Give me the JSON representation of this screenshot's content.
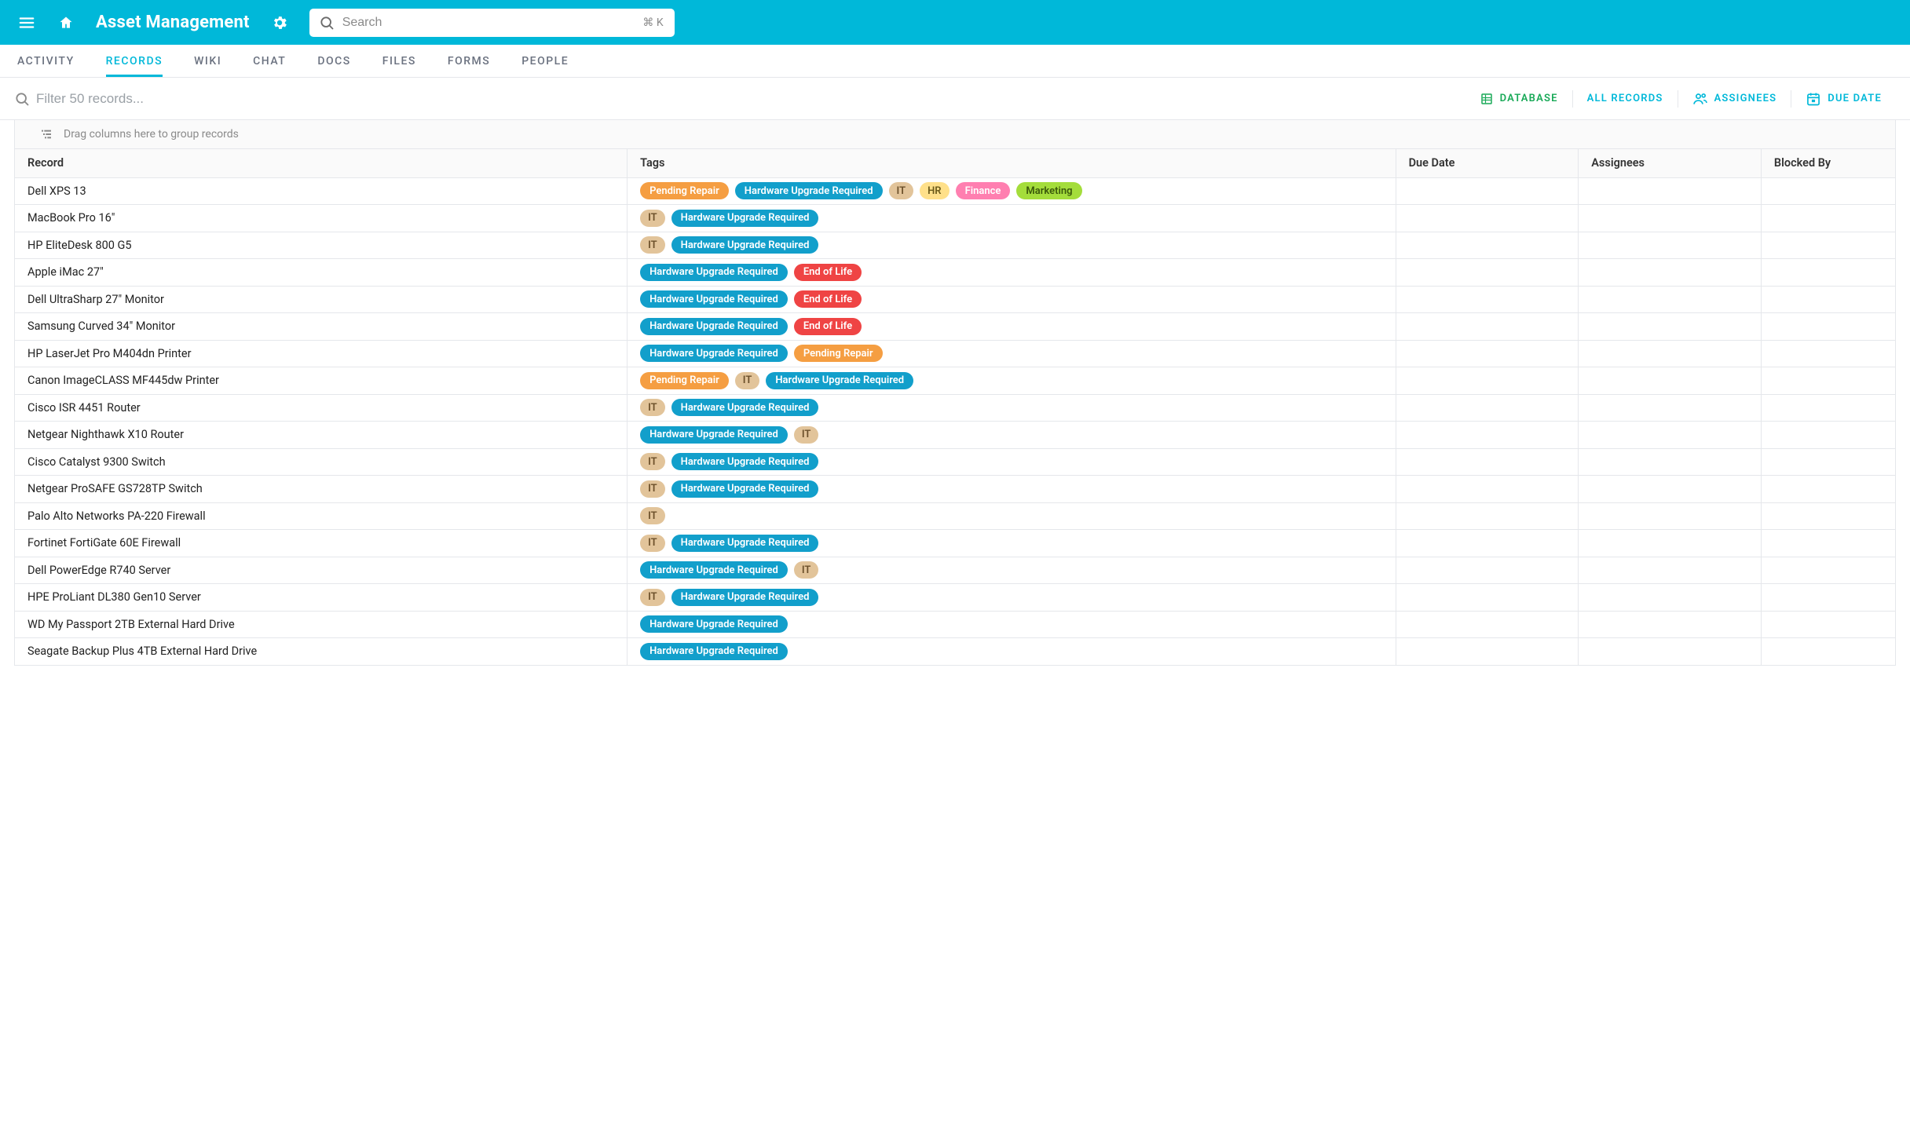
{
  "header": {
    "title": "Asset Management",
    "search_placeholder": "Search",
    "search_shortcut": "⌘ K"
  },
  "nav_tabs": [
    {
      "id": "activity",
      "label": "ACTIVITY",
      "active": false
    },
    {
      "id": "records",
      "label": "RECORDS",
      "active": true
    },
    {
      "id": "wiki",
      "label": "WIKI",
      "active": false
    },
    {
      "id": "chat",
      "label": "CHAT",
      "active": false
    },
    {
      "id": "docs",
      "label": "DOCS",
      "active": false
    },
    {
      "id": "files",
      "label": "FILES",
      "active": false
    },
    {
      "id": "forms",
      "label": "FORMS",
      "active": false
    },
    {
      "id": "people",
      "label": "PEOPLE",
      "active": false
    }
  ],
  "toolbar": {
    "filter_placeholder": "Filter 50 records...",
    "actions": {
      "database": "DATABASE",
      "allrecords": "ALL RECORDS",
      "assignees": "ASSIGNEES",
      "duedate": "DUE DATE"
    }
  },
  "groupbar": {
    "hint": "Drag columns here to group records"
  },
  "columns": [
    {
      "id": "record",
      "label": "Record"
    },
    {
      "id": "tags",
      "label": "Tags"
    },
    {
      "id": "due",
      "label": "Due Date"
    },
    {
      "id": "assign",
      "label": "Assignees"
    },
    {
      "id": "blocked",
      "label": "Blocked By"
    }
  ],
  "tag_palette": {
    "Pending Repair": {
      "bg": "#f59e42",
      "fg": "#ffffff"
    },
    "Hardware Upgrade Required": {
      "bg": "#129fcb",
      "fg": "#ffffff"
    },
    "IT": {
      "bg": "#e2c49a",
      "fg": "#6b4f2a"
    },
    "HR": {
      "bg": "#ffe08a",
      "fg": "#6b5a1a"
    },
    "Finance": {
      "bg": "#ff7fb0",
      "fg": "#ffffff"
    },
    "Marketing": {
      "bg": "#a4dd3b",
      "fg": "#3b5a0b"
    },
    "End of Life": {
      "bg": "#ef4444",
      "fg": "#ffffff"
    }
  },
  "rows": [
    {
      "record": "Dell XPS 13",
      "tags": [
        "Pending Repair",
        "Hardware Upgrade Required",
        "IT",
        "HR",
        "Finance",
        "Marketing"
      ],
      "due": "",
      "assignees": "",
      "blocked": ""
    },
    {
      "record": "MacBook Pro 16\"",
      "tags": [
        "IT",
        "Hardware Upgrade Required"
      ],
      "due": "",
      "assignees": "",
      "blocked": ""
    },
    {
      "record": "HP EliteDesk 800 G5",
      "tags": [
        "IT",
        "Hardware Upgrade Required"
      ],
      "due": "",
      "assignees": "",
      "blocked": ""
    },
    {
      "record": "Apple iMac 27\"",
      "tags": [
        "Hardware Upgrade Required",
        "End of Life"
      ],
      "due": "",
      "assignees": "",
      "blocked": ""
    },
    {
      "record": "Dell UltraSharp 27\" Monitor",
      "tags": [
        "Hardware Upgrade Required",
        "End of Life"
      ],
      "due": "",
      "assignees": "",
      "blocked": ""
    },
    {
      "record": "Samsung Curved 34\" Monitor",
      "tags": [
        "Hardware Upgrade Required",
        "End of Life"
      ],
      "due": "",
      "assignees": "",
      "blocked": ""
    },
    {
      "record": "HP LaserJet Pro M404dn Printer",
      "tags": [
        "Hardware Upgrade Required",
        "Pending Repair"
      ],
      "due": "",
      "assignees": "",
      "blocked": ""
    },
    {
      "record": "Canon ImageCLASS MF445dw Printer",
      "tags": [
        "Pending Repair",
        "IT",
        "Hardware Upgrade Required"
      ],
      "due": "",
      "assignees": "",
      "blocked": ""
    },
    {
      "record": "Cisco ISR 4451 Router",
      "tags": [
        "IT",
        "Hardware Upgrade Required"
      ],
      "due": "",
      "assignees": "",
      "blocked": ""
    },
    {
      "record": "Netgear Nighthawk X10 Router",
      "tags": [
        "Hardware Upgrade Required",
        "IT"
      ],
      "due": "",
      "assignees": "",
      "blocked": ""
    },
    {
      "record": "Cisco Catalyst 9300 Switch",
      "tags": [
        "IT",
        "Hardware Upgrade Required"
      ],
      "due": "",
      "assignees": "",
      "blocked": ""
    },
    {
      "record": "Netgear ProSAFE GS728TP Switch",
      "tags": [
        "IT",
        "Hardware Upgrade Required"
      ],
      "due": "",
      "assignees": "",
      "blocked": ""
    },
    {
      "record": "Palo Alto Networks PA-220 Firewall",
      "tags": [
        "IT"
      ],
      "due": "",
      "assignees": "",
      "blocked": ""
    },
    {
      "record": "Fortinet FortiGate 60E Firewall",
      "tags": [
        "IT",
        "Hardware Upgrade Required"
      ],
      "due": "",
      "assignees": "",
      "blocked": ""
    },
    {
      "record": "Dell PowerEdge R740 Server",
      "tags": [
        "Hardware Upgrade Required",
        "IT"
      ],
      "due": "",
      "assignees": "",
      "blocked": ""
    },
    {
      "record": "HPE ProLiant DL380 Gen10 Server",
      "tags": [
        "IT",
        "Hardware Upgrade Required"
      ],
      "due": "",
      "assignees": "",
      "blocked": ""
    },
    {
      "record": "WD My Passport 2TB External Hard Drive",
      "tags": [
        "Hardware Upgrade Required"
      ],
      "due": "",
      "assignees": "",
      "blocked": ""
    },
    {
      "record": "Seagate Backup Plus 4TB External Hard Drive",
      "tags": [
        "Hardware Upgrade Required"
      ],
      "due": "",
      "assignees": "",
      "blocked": ""
    }
  ]
}
